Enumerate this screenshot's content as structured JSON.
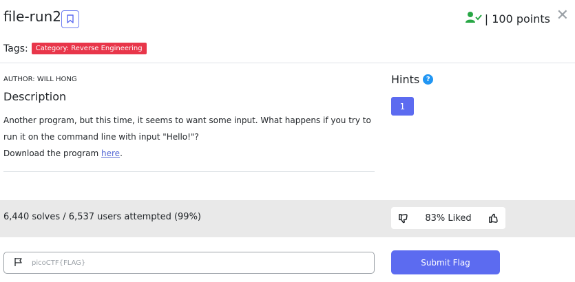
{
  "challenge": {
    "title": "file-run2",
    "points_label": "| 100 points",
    "tags_label": "Tags:",
    "tag": "Category: Reverse Engineering"
  },
  "author": "AUTHOR: WILL HONG",
  "description": {
    "heading": "Description",
    "text": "Another program, but this time, it seems to want some input. What happens if you try to run it on the command line with input \"Hello!\"?",
    "download_prefix": "Download the program ",
    "download_link": "here",
    "download_suffix": "."
  },
  "hints": {
    "heading": "Hints",
    "help_glyph": "?",
    "items": [
      "1"
    ]
  },
  "stats": {
    "solves_text": "6,440 solves / 6,537 users attempted (99%)",
    "liked_text": "83% Liked"
  },
  "flag": {
    "placeholder": "picoCTF{FLAG}",
    "submit_label": "Submit Flag"
  },
  "icons": {
    "bookmark": "bookmark-icon",
    "solved_user": "user-check-icon",
    "close": "close-icon",
    "help": "question-circle-icon",
    "thumbs_down": "thumbs-down-icon",
    "thumbs_up": "thumbs-up-icon",
    "flag": "flag-icon"
  },
  "colors": {
    "accent": "#5c6bf0",
    "tag_red": "#e8364a",
    "solved_green": "#28a745",
    "help_blue": "#2196f3",
    "stats_bg": "#e9e9e9"
  }
}
